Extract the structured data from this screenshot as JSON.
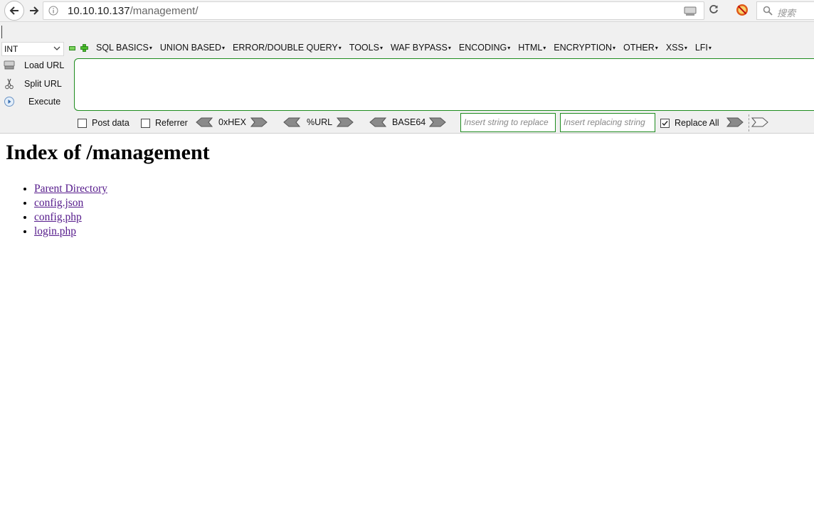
{
  "browser": {
    "url_host": "10.10.10.137",
    "url_path": "/management/",
    "search_placeholder": "搜索"
  },
  "hackbar": {
    "select_value": "INT",
    "menus": [
      "SQL BASICS",
      "UNION BASED",
      "ERROR/DOUBLE QUERY",
      "TOOLS",
      "WAF BYPASS",
      "ENCODING",
      "HTML",
      "ENCRYPTION",
      "OTHER",
      "XSS",
      "LFI"
    ],
    "load_url": "Load URL",
    "split_url": "Split URL",
    "execute": "Execute",
    "post_data": "Post data",
    "referrer": "Referrer",
    "hex": "0xHEX",
    "url_enc": "%URL",
    "base64": "BASE64",
    "replace_from_placeholder": "Insert string to replace",
    "replace_to_placeholder": "Insert replacing string",
    "replace_all": "Replace All",
    "replace_all_checked": true
  },
  "page": {
    "title": "Index of /management",
    "items": [
      "Parent Directory",
      "config.json",
      "config.php",
      "login.php"
    ]
  },
  "colors": {
    "link_visited": "#551a8b",
    "hackbar_border": "#1e8c1e"
  }
}
